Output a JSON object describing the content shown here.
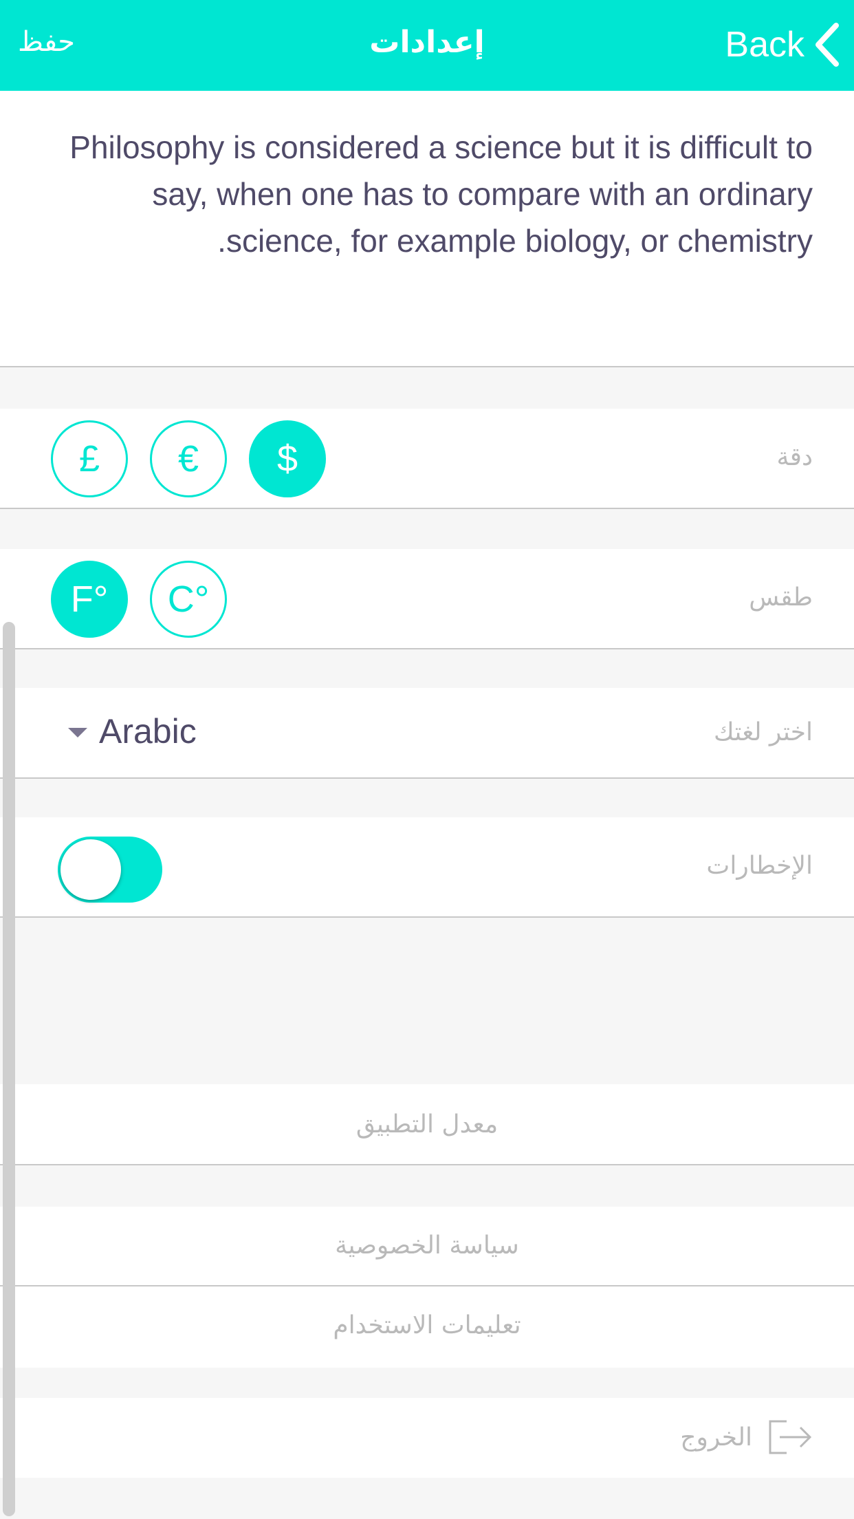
{
  "header": {
    "save_label": "حفظ",
    "title": "إعدادات",
    "back_label": "Back"
  },
  "description": {
    "text": "Philosophy is considered a science but it is difficult to say, when one has to compare with an ordinary science, for example biology, or chemistry."
  },
  "currency": {
    "label": "دقة",
    "options": [
      "£",
      "€",
      "$"
    ],
    "selected": "$"
  },
  "temperature": {
    "label": "طقس",
    "options": [
      "F°",
      "C°"
    ],
    "selected": "F°"
  },
  "language": {
    "label": "اختر لغتك",
    "selected": "Arabic"
  },
  "notifications": {
    "label": "الإخطارات",
    "enabled": true
  },
  "links": {
    "rate_app": "معدل التطبيق",
    "privacy_policy": "سياسة الخصوصية",
    "terms_of_use": "تعليمات الاستخدام",
    "logout": "الخروج"
  },
  "colors": {
    "accent": "#00e6d2",
    "text_dark": "#4f4a68",
    "label_gray": "#b9b9b9"
  },
  "icons": {
    "back": "chevron-left-icon",
    "caret": "caret-down-icon",
    "logout": "logout-icon"
  }
}
